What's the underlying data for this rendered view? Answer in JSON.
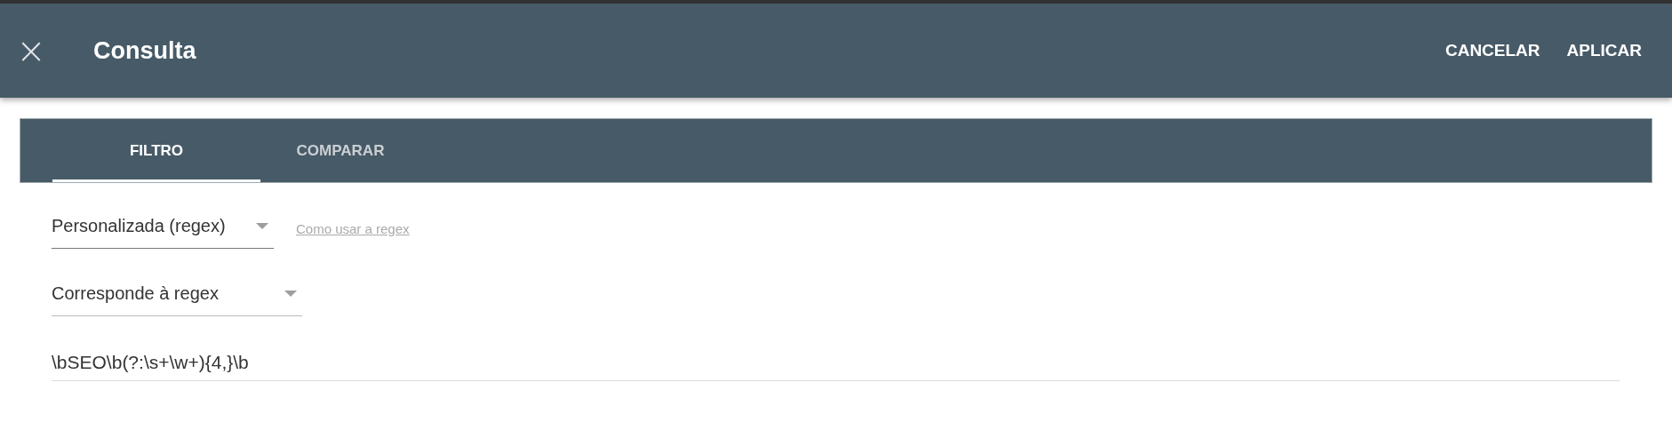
{
  "header": {
    "close": "×",
    "title": "Consulta",
    "actions": [
      "CANCELAR",
      "APLICAR"
    ]
  },
  "tabs": [
    {
      "label": "FILTRO",
      "selected": true
    },
    {
      "label": "COMPARAR",
      "selected": false
    }
  ],
  "filter": {
    "type_select": "Personalizada (regex)",
    "help_link": "Como usar a regex",
    "match_select": "Corresponde à regex",
    "value": "\\bSEO\\b(?:\\s+\\w+){4,}\\b"
  }
}
